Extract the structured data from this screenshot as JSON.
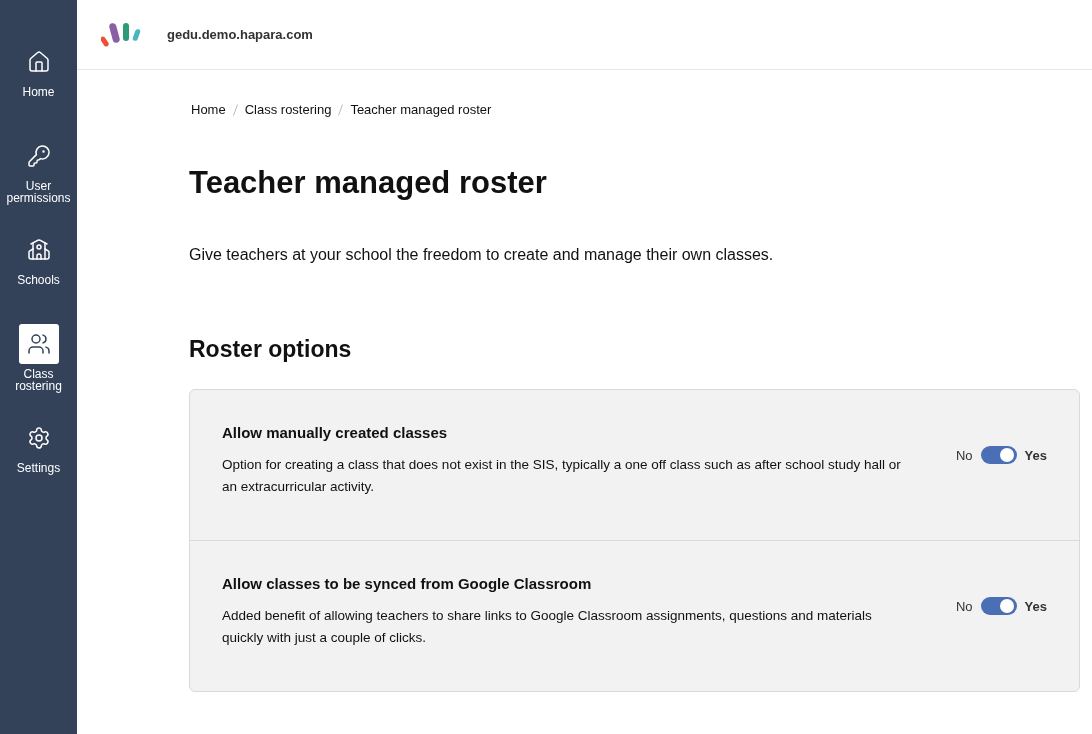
{
  "sidebar": {
    "items": [
      {
        "label": "Home",
        "selected": false
      },
      {
        "label": "User permissions",
        "selected": false
      },
      {
        "label": "Schools",
        "selected": false
      },
      {
        "label": "Class rostering",
        "selected": true
      },
      {
        "label": "Settings",
        "selected": false
      }
    ]
  },
  "header": {
    "domain": "gedu.demo.hapara.com"
  },
  "breadcrumbs": [
    "Home",
    "Class rostering",
    "Teacher managed roster"
  ],
  "title": "Teacher managed roster",
  "description": "Give teachers at your school the freedom to create and manage their own classes.",
  "section_title": "Roster options",
  "options": [
    {
      "title": "Allow manually created classes",
      "text": "Option for creating a class that does not exist in the SIS, typically a one off class such as after school study hall or an extracurricular activity.",
      "off_label": "No",
      "on_label": "Yes",
      "on": true
    },
    {
      "title": "Allow classes to be synced from Google Classroom",
      "text": "Added benefit of allowing teachers to share links to Google Classroom assignments, questions and materials quickly with just a couple of clicks.",
      "off_label": "No",
      "on_label": "Yes",
      "on": true
    }
  ]
}
